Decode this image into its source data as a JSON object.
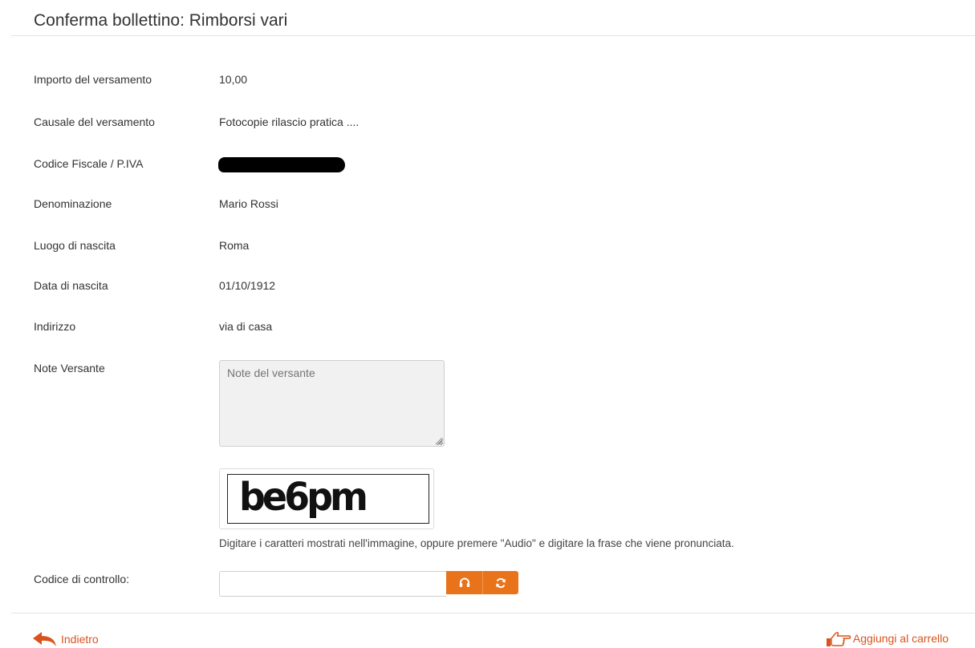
{
  "page": {
    "title": "Conferma bollettino: Rimborsi vari"
  },
  "fields": [
    {
      "label": "Importo del versamento",
      "value": "10,00"
    },
    {
      "label": "Causale del versamento",
      "value": "Fotocopie rilascio pratica ...."
    },
    {
      "label": "Codice Fiscale / P.IVA",
      "value": ""
    },
    {
      "label": "Denominazione",
      "value": "Mario Rossi"
    },
    {
      "label": "Luogo di nascita",
      "value": "Roma"
    },
    {
      "label": "Data di nascita",
      "value": "01/10/1912"
    },
    {
      "label": "Indirizzo",
      "value": "via di casa"
    }
  ],
  "notes": {
    "label": "Note Versante",
    "placeholder": "Note del versante",
    "value": ""
  },
  "captcha": {
    "text": "be6pm",
    "help": "Digitare i caratteri mostrati nell'immagine, oppure premere \"Audio\" e digitare la frase che viene pronunciata."
  },
  "code": {
    "label": "Codice di controllo:",
    "value": ""
  },
  "icons": {
    "audio": "headphones-icon",
    "refresh": "refresh-icon",
    "back": "reply-arrow-icon",
    "cart": "hand-pointer-icon"
  },
  "footer": {
    "back_label": "Indietro",
    "cart_label": "Aggiungi al carrello"
  },
  "colors": {
    "accent": "#e8731a",
    "link": "#d9531e"
  }
}
